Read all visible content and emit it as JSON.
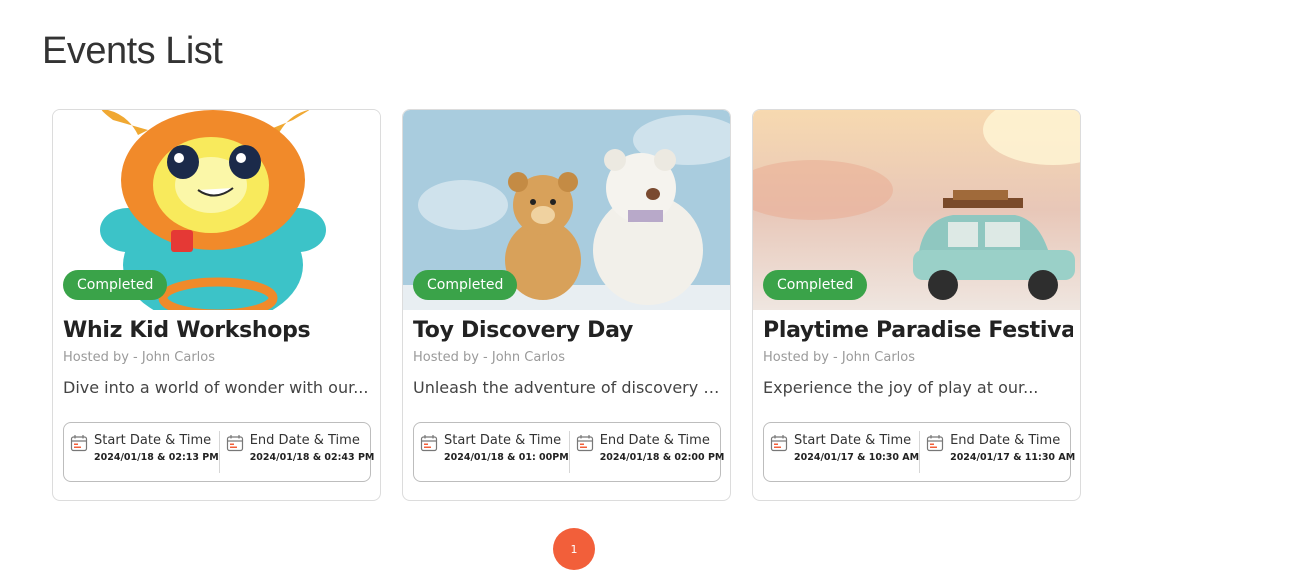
{
  "page": {
    "title": "Events List"
  },
  "colors": {
    "badge": "#3aa349",
    "pagination": "#f25f3a"
  },
  "events": [
    {
      "status": "Completed",
      "title": "Whiz Kid Workshops",
      "host": "Hosted by - John Carlos",
      "description": "Dive into a world of wonder with our...",
      "start_label": "Start Date & Time",
      "start_value": "2024/01/18 & 02:13 PM",
      "end_label": "End Date & Time",
      "end_value": "2024/01/18 & 02:43 PM",
      "image": "toy-robot-image"
    },
    {
      "status": "Completed",
      "title": "Toy Discovery Day",
      "host": "Hosted by - John Carlos",
      "description": "Unleash the adventure of discovery a...",
      "start_label": "Start Date & Time",
      "start_value": "2024/01/18 & 01: 00PM",
      "end_label": "End Date & Time",
      "end_value": "2024/01/18 & 02:00 PM",
      "image": "teddy-bears-image"
    },
    {
      "status": "Completed",
      "title": "Playtime Paradise Festival",
      "host": "Hosted by - John Carlos",
      "description": "Experience the joy of play at our...",
      "start_label": "Start Date & Time",
      "start_value": "2024/01/17 & 10:30 AM",
      "end_label": "End Date & Time",
      "end_value": "2024/01/17 & 11:30 AM",
      "image": "toy-car-image"
    }
  ],
  "pagination": {
    "current_page": "1"
  }
}
